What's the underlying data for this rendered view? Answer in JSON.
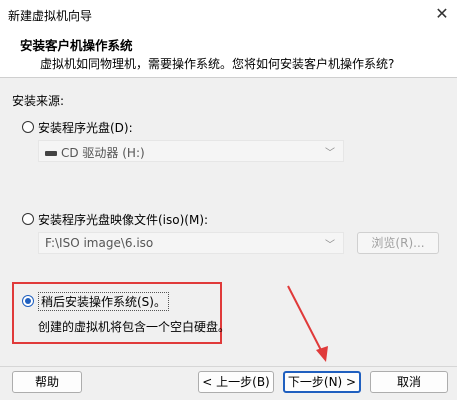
{
  "window": {
    "title": "新建虚拟机向导",
    "close_glyph": "✕"
  },
  "header": {
    "title": "安装客户机操作系统",
    "subtitle": "虚拟机如同物理机，需要操作系统。您将如何安装客户机操作系统?"
  },
  "source": {
    "label": "安装来源:",
    "options": [
      {
        "label": "安装程序光盘(D):",
        "selected": false
      },
      {
        "label": "安装程序光盘映像文件(iso)(M):",
        "selected": false
      },
      {
        "label": "稍后安装操作系统(S)。",
        "selected": true
      }
    ],
    "disc_combo": {
      "value": "CD 驱动器 (H:)"
    },
    "iso_combo": {
      "value": "F:\\ISO image\\6.iso"
    },
    "browse_label": "浏览(R)...",
    "later_desc": "创建的虚拟机将包含一个空白硬盘。"
  },
  "footer": {
    "help_label": "帮助",
    "back_label": "< 上一步(B)",
    "next_label": "下一步(N) >",
    "cancel_label": "取消"
  },
  "colors": {
    "accent": "#1f5fbf",
    "highlight_box": "#e03a3a",
    "arrow": "#e03a3a"
  }
}
